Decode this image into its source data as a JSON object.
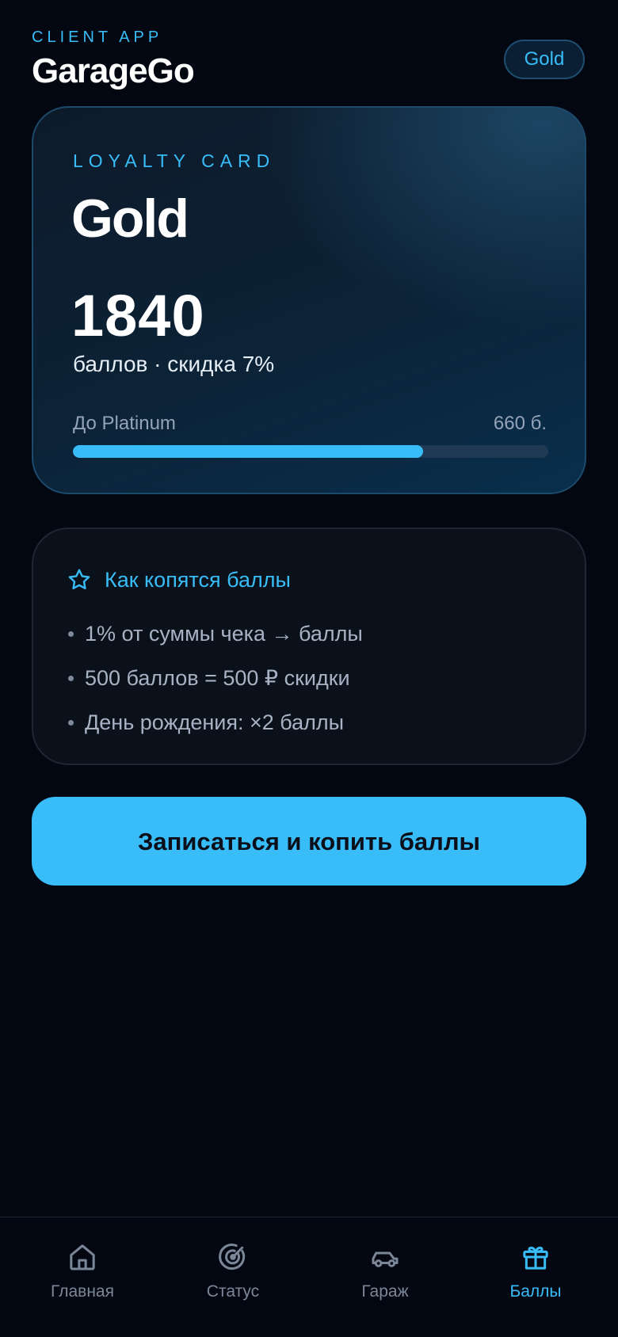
{
  "header": {
    "app_label": "CLIENT APP",
    "app_title": "GarageGo",
    "tier_badge": "Gold"
  },
  "loyalty_card": {
    "label": "LOYALTY CARD",
    "tier": "Gold",
    "points": "1840",
    "points_caption": "баллов · скидка 7%",
    "progress_label": "До Platinum",
    "progress_remaining": "660 б.",
    "progress_fraction": 0.736
  },
  "info": {
    "icon": "star-icon",
    "title": "Как копятся баллы",
    "items": [
      "1% от суммы чека → баллы",
      "500 баллов = 500 ₽ скидки",
      "День рождения: ×2 баллы"
    ]
  },
  "cta": {
    "label": "Записаться и копить баллы"
  },
  "nav": {
    "items": [
      {
        "label": "Главная",
        "icon": "home-icon",
        "active": false
      },
      {
        "label": "Статус",
        "icon": "radar-icon",
        "active": false
      },
      {
        "label": "Гараж",
        "icon": "car-icon",
        "active": false
      },
      {
        "label": "Баллы",
        "icon": "gift-icon",
        "active": true
      }
    ]
  },
  "colors": {
    "accent": "#38bdf8",
    "background": "#030712",
    "inactive": "#7b8798"
  }
}
